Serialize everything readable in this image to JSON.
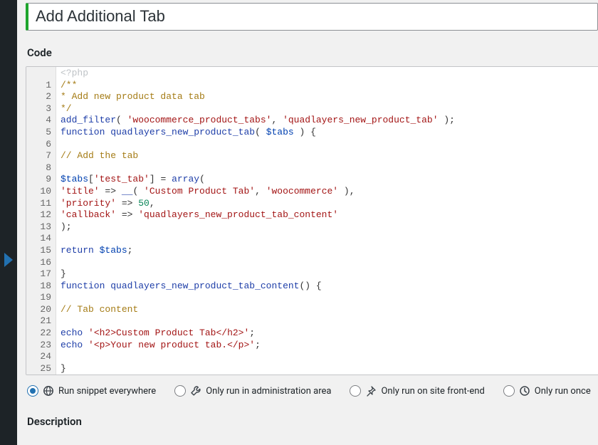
{
  "title": "Add Additional Tab",
  "headings": {
    "code": "Code",
    "description": "Description"
  },
  "php_tag": "<?php",
  "code": {
    "lines": [
      {
        "n": 1,
        "tokens": [
          {
            "cls": "tok-cmt",
            "t": "/**"
          }
        ]
      },
      {
        "n": 2,
        "tokens": [
          {
            "cls": "tok-cmt",
            "t": "* Add new product data tab"
          }
        ]
      },
      {
        "n": 3,
        "tokens": [
          {
            "cls": "tok-cmt",
            "t": "*/"
          }
        ]
      },
      {
        "n": 4,
        "tokens": [
          {
            "cls": "tok-fn",
            "t": "add_filter"
          },
          {
            "cls": "tok-punc",
            "t": "( "
          },
          {
            "cls": "tok-str",
            "t": "'woocommerce_product_tabs'"
          },
          {
            "cls": "tok-punc",
            "t": ", "
          },
          {
            "cls": "tok-str",
            "t": "'quadlayers_new_product_tab'"
          },
          {
            "cls": "tok-punc",
            "t": " );"
          }
        ]
      },
      {
        "n": 5,
        "tokens": [
          {
            "cls": "tok-key",
            "t": "function"
          },
          {
            "cls": "tok-punc",
            "t": " "
          },
          {
            "cls": "tok-def",
            "t": "quadlayers_new_product_tab"
          },
          {
            "cls": "tok-punc",
            "t": "( "
          },
          {
            "cls": "tok-var",
            "t": "$tabs"
          },
          {
            "cls": "tok-punc",
            "t": " ) {"
          }
        ]
      },
      {
        "n": 6,
        "tokens": [
          {
            "cls": "tok-punc",
            "t": ""
          }
        ]
      },
      {
        "n": 7,
        "tokens": [
          {
            "cls": "tok-cmt",
            "t": "// Add the tab"
          }
        ]
      },
      {
        "n": 8,
        "tokens": [
          {
            "cls": "tok-punc",
            "t": ""
          }
        ]
      },
      {
        "n": 9,
        "tokens": [
          {
            "cls": "tok-var",
            "t": "$tabs"
          },
          {
            "cls": "tok-punc",
            "t": "["
          },
          {
            "cls": "tok-str",
            "t": "'test_tab'"
          },
          {
            "cls": "tok-punc",
            "t": "] = "
          },
          {
            "cls": "tok-key",
            "t": "array"
          },
          {
            "cls": "tok-punc",
            "t": "("
          }
        ]
      },
      {
        "n": 10,
        "tokens": [
          {
            "cls": "tok-str",
            "t": "'title'"
          },
          {
            "cls": "tok-punc",
            "t": " => "
          },
          {
            "cls": "tok-fn",
            "t": "__"
          },
          {
            "cls": "tok-punc",
            "t": "( "
          },
          {
            "cls": "tok-str",
            "t": "'Custom Product Tab'"
          },
          {
            "cls": "tok-punc",
            "t": ", "
          },
          {
            "cls": "tok-str",
            "t": "'woocommerce'"
          },
          {
            "cls": "tok-punc",
            "t": " ),"
          }
        ]
      },
      {
        "n": 11,
        "tokens": [
          {
            "cls": "tok-str",
            "t": "'priority'"
          },
          {
            "cls": "tok-punc",
            "t": " => "
          },
          {
            "cls": "tok-num",
            "t": "50"
          },
          {
            "cls": "tok-punc",
            "t": ","
          }
        ]
      },
      {
        "n": 12,
        "tokens": [
          {
            "cls": "tok-str",
            "t": "'callback'"
          },
          {
            "cls": "tok-punc",
            "t": " => "
          },
          {
            "cls": "tok-str",
            "t": "'quadlayers_new_product_tab_content'"
          }
        ]
      },
      {
        "n": 13,
        "tokens": [
          {
            "cls": "tok-punc",
            "t": ");"
          }
        ]
      },
      {
        "n": 14,
        "tokens": [
          {
            "cls": "tok-punc",
            "t": ""
          }
        ]
      },
      {
        "n": 15,
        "tokens": [
          {
            "cls": "tok-key",
            "t": "return"
          },
          {
            "cls": "tok-punc",
            "t": " "
          },
          {
            "cls": "tok-var",
            "t": "$tabs"
          },
          {
            "cls": "tok-punc",
            "t": ";"
          }
        ]
      },
      {
        "n": 16,
        "tokens": [
          {
            "cls": "tok-punc",
            "t": ""
          }
        ]
      },
      {
        "n": 17,
        "tokens": [
          {
            "cls": "tok-punc",
            "t": "}"
          }
        ]
      },
      {
        "n": 18,
        "tokens": [
          {
            "cls": "tok-key",
            "t": "function"
          },
          {
            "cls": "tok-punc",
            "t": " "
          },
          {
            "cls": "tok-def",
            "t": "quadlayers_new_product_tab_content"
          },
          {
            "cls": "tok-punc",
            "t": "() {"
          }
        ]
      },
      {
        "n": 19,
        "tokens": [
          {
            "cls": "tok-punc",
            "t": ""
          }
        ]
      },
      {
        "n": 20,
        "tokens": [
          {
            "cls": "tok-cmt",
            "t": "// Tab content"
          }
        ]
      },
      {
        "n": 21,
        "tokens": [
          {
            "cls": "tok-punc",
            "t": ""
          }
        ]
      },
      {
        "n": 22,
        "tokens": [
          {
            "cls": "tok-echo",
            "t": "echo"
          },
          {
            "cls": "tok-punc",
            "t": " "
          },
          {
            "cls": "tok-str",
            "t": "'<h2>Custom Product Tab</h2>'"
          },
          {
            "cls": "tok-punc",
            "t": ";"
          }
        ]
      },
      {
        "n": 23,
        "tokens": [
          {
            "cls": "tok-echo",
            "t": "echo"
          },
          {
            "cls": "tok-punc",
            "t": " "
          },
          {
            "cls": "tok-str",
            "t": "'<p>Your new product tab.</p>'"
          },
          {
            "cls": "tok-punc",
            "t": ";"
          }
        ]
      },
      {
        "n": 24,
        "tokens": [
          {
            "cls": "tok-punc",
            "t": ""
          }
        ]
      },
      {
        "n": 25,
        "tokens": [
          {
            "cls": "tok-punc",
            "t": "}"
          }
        ]
      }
    ]
  },
  "run_options": [
    {
      "key": "everywhere",
      "label": "Run snippet everywhere",
      "icon": "globe",
      "checked": true
    },
    {
      "key": "admin",
      "label": "Only run in administration area",
      "icon": "wrench",
      "checked": false
    },
    {
      "key": "frontend",
      "label": "Only run on site front-end",
      "icon": "pin",
      "checked": false
    },
    {
      "key": "once",
      "label": "Only run once",
      "icon": "clock",
      "checked": false
    }
  ]
}
